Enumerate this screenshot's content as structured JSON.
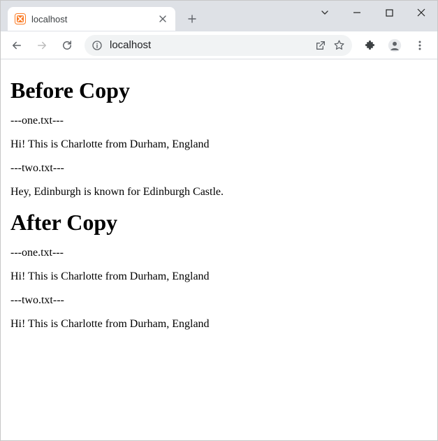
{
  "tab": {
    "title": "localhost"
  },
  "address": {
    "text": "localhost"
  },
  "page": {
    "h1_before": "Before Copy",
    "before": {
      "label1": "---one.txt---",
      "content1": "Hi! This is Charlotte from Durham, England",
      "label2": "---two.txt---",
      "content2": "Hey, Edinburgh is known for Edinburgh Castle."
    },
    "h1_after": "After Copy",
    "after": {
      "label1": "---one.txt---",
      "content1": "Hi! This is Charlotte from Durham, England",
      "label2": "---two.txt---",
      "content2": "Hi! This is Charlotte from Durham, England"
    }
  }
}
